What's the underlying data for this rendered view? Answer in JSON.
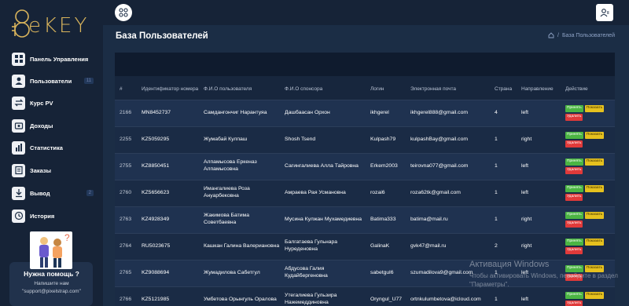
{
  "brand": {
    "logo_text": "eKEY"
  },
  "sidebar": {
    "items": [
      {
        "label": "Панель Управления",
        "icon": "dashboard-icon",
        "badge": ""
      },
      {
        "label": "Пользователи",
        "icon": "users-icon",
        "badge": "11"
      },
      {
        "label": "Курс PV",
        "icon": "exchange-icon",
        "badge": ""
      },
      {
        "label": "Доходы",
        "icon": "income-icon",
        "badge": ""
      },
      {
        "label": "Статистика",
        "icon": "chart-icon",
        "badge": ""
      },
      {
        "label": "Заказы",
        "icon": "orders-icon",
        "badge": ""
      },
      {
        "label": "Вывод",
        "icon": "withdraw-icon",
        "badge": "2"
      },
      {
        "label": "История",
        "icon": "history-icon",
        "badge": ""
      }
    ],
    "help": {
      "title": "Нужна помощь ?",
      "line1": "Напишите нам",
      "line2": "\"support@pixelstrap.com\""
    }
  },
  "page": {
    "title": "База Пользователей",
    "breadcrumb": "База Пользователей",
    "breadcrumb_sep": "/"
  },
  "table": {
    "headers": [
      "#",
      "Идентификатор номера",
      "Ф.И.О пользователя",
      "Ф.И.О спонсора",
      "Логин",
      "Электронная почта",
      "Страна",
      "Направление",
      "Действие"
    ],
    "actions": {
      "accept": "Принять",
      "show": "Показать",
      "delete": "Удалить"
    },
    "rows": [
      {
        "num": "2166",
        "id": "MN8452737",
        "user": "Самдангончиг Нарантуяа",
        "sponsor": "Дашбаасан Орхон",
        "login": "ikhgerel",
        "email": "ikhgerel888@gmail.com",
        "country": "4",
        "direction": "left"
      },
      {
        "num": "2255",
        "id": "KZ5059295",
        "user": "Жумабай Кулпаш",
        "sponsor": "Shosh Tsend",
        "login": "Kulpash79",
        "email": "kulpashBay@gmail.com",
        "country": "1",
        "direction": "right"
      },
      {
        "num": "2755",
        "id": "KZ8850451",
        "user": "Алпамысова Еркеназ Алпамысовна",
        "sponsor": "Сагингалиева Алла Тайровна",
        "login": "Erkem2003",
        "email": "teirovna077@gmail.com",
        "country": "1",
        "direction": "left"
      },
      {
        "num": "2760",
        "id": "KZ5656623",
        "user": "Имангалиева Роза Ануарбековна",
        "sponsor": "Амраева Рая Усмановна",
        "login": "rozai6",
        "email": "roza62tk@gmail.com",
        "country": "1",
        "direction": "left"
      },
      {
        "num": "2763",
        "id": "KZ4928349",
        "user": "Жакимова Батима Советбаевна",
        "sponsor": "Мусина Кулжан Мухамедиевна",
        "login": "Batima333",
        "email": "batima@mail.ru",
        "country": "1",
        "direction": "right"
      },
      {
        "num": "2764",
        "id": "RU5023675",
        "user": "Кашкан Галина Валериановна",
        "sponsor": "Балгатаева Гульнара Нуреденовна",
        "login": "GalinaK",
        "email": "gvk47@mail.ru",
        "country": "2",
        "direction": "right"
      },
      {
        "num": "2765",
        "id": "KZ9088694",
        "user": "Жумадилова Сабетгул",
        "sponsor": "Абдусова Галия Кудайбергеновна",
        "login": "sabetgul6",
        "email": "szumadilova9@gmail.com",
        "country": "1",
        "direction": "left"
      },
      {
        "num": "2766",
        "id": "KZ5121985",
        "user": "Умбетова Орынгуль Оралова",
        "sponsor": "Утегалиева Гульзира Нажемеддиновна",
        "login": "Oryngul_U77",
        "email": "ortnkulumbetova@icloud.com",
        "country": "1",
        "direction": "left"
      }
    ]
  },
  "watermark": {
    "title": "Активация Windows",
    "text": "Чтобы активировать Windows, перейдите в раздел \"Параметры\"."
  }
}
